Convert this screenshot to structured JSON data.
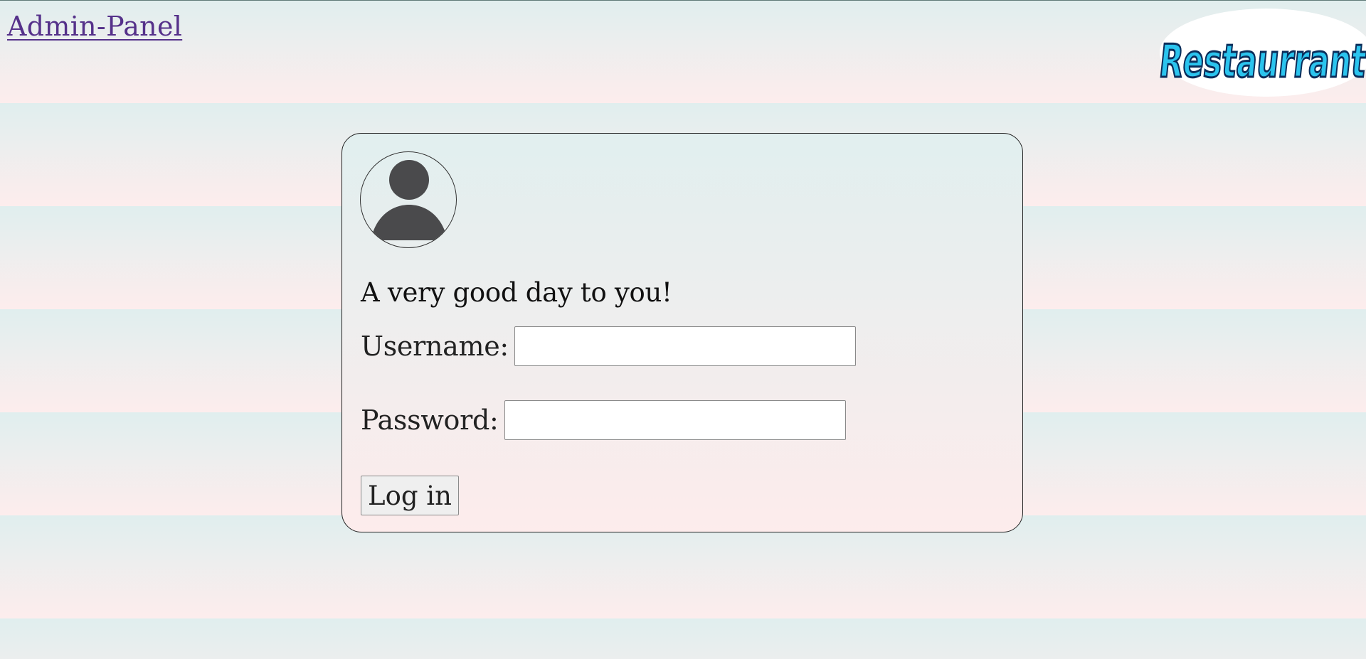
{
  "header": {
    "admin_link_label": "Admin-Panel",
    "logo_text": "Restaurrant"
  },
  "login_card": {
    "avatar_icon": "user-avatar-icon",
    "greeting": "A very good day to you!",
    "username_label": "Username:",
    "username_value": "",
    "password_label": "Password:",
    "password_value": "",
    "login_button_label": "Log in"
  },
  "colors": {
    "background_top": "#e0eeee",
    "background_bottom": "#fdeded",
    "link": "#55318a",
    "logo_fill": "#2bc4ee",
    "logo_outline": "#0a2d5a",
    "avatar_fill": "#4a4a4c"
  }
}
